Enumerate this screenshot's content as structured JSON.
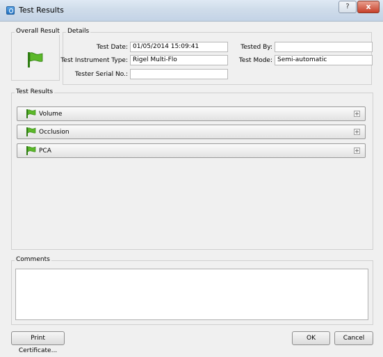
{
  "window": {
    "title": "Test Results",
    "help_label": "?",
    "close_label": "x"
  },
  "overall": {
    "label": "Overall Result",
    "icon": "green-flag-icon"
  },
  "details": {
    "label": "Details",
    "test_date_label": "Test Date:",
    "test_date": "01/05/2014 15:09:41",
    "instrument_label": "Test Instrument Type:",
    "instrument": "Rigel Multi-Flo",
    "serial_label": "Tester Serial No.:",
    "serial": "",
    "tested_by_label": "Tested By:",
    "tested_by": "",
    "test_mode_label": "Test Mode:",
    "test_mode": "Semi-automatic"
  },
  "results": {
    "label": "Test Results",
    "items": [
      {
        "label": "Volume"
      },
      {
        "label": "Occlusion"
      },
      {
        "label": "PCA"
      }
    ]
  },
  "comments": {
    "label": "Comments",
    "value": ""
  },
  "buttons": {
    "print": "Print Certificate...",
    "ok": "OK",
    "cancel": "Cancel"
  },
  "colors": {
    "flag_green": "#5cb82a",
    "flag_dark": "#2f7d12"
  }
}
